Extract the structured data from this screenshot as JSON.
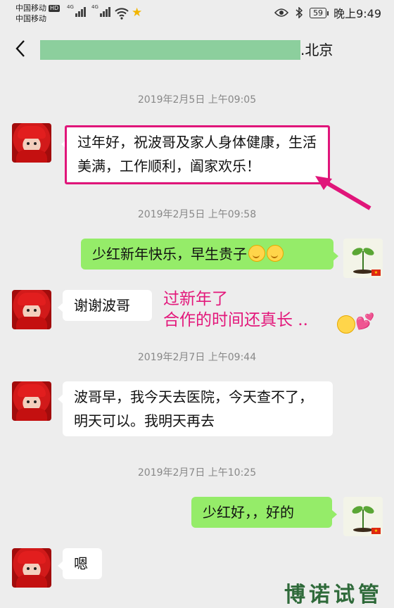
{
  "status_bar": {
    "carrier_1": "中国移动",
    "carrier_2": "中国移动",
    "hd": "HD",
    "net_1": "4G",
    "net_2": "4G",
    "battery": "59",
    "time": "晚上9:49"
  },
  "header": {
    "title_suffix": ".北京"
  },
  "messages": [
    {
      "type": "timestamp",
      "text": "2019年2月5日 上午09:05"
    },
    {
      "type": "in",
      "text": "过年好，祝波哥及家人身体健康，生活美满，工作顺利，阖家欢乐！"
    },
    {
      "type": "timestamp",
      "text": "2019年2月5日 上午09:58"
    },
    {
      "type": "out",
      "text": "少红新年快乐，早生贵子"
    },
    {
      "type": "in",
      "text": "谢谢波哥"
    },
    {
      "type": "timestamp",
      "text": "2019年2月7日 上午09:44"
    },
    {
      "type": "in",
      "text": "波哥早，我今天去医院，今天查不了，明天可以。我明天再去"
    },
    {
      "type": "timestamp",
      "text": "2019年2月7日 上午10:25"
    },
    {
      "type": "out",
      "text": "少红好，，好的"
    },
    {
      "type": "in",
      "text": "嗯"
    }
  ],
  "annotation": {
    "line_1": "过新年了",
    "line_2": "合作的时间还真长 .."
  },
  "watermark": "博诺试管",
  "colors": {
    "background": "#ededed",
    "outgoing_bubble": "#95ec69",
    "incoming_bubble": "#ffffff",
    "highlight": "#e0157a",
    "masked_name": "#8ccf9d"
  }
}
